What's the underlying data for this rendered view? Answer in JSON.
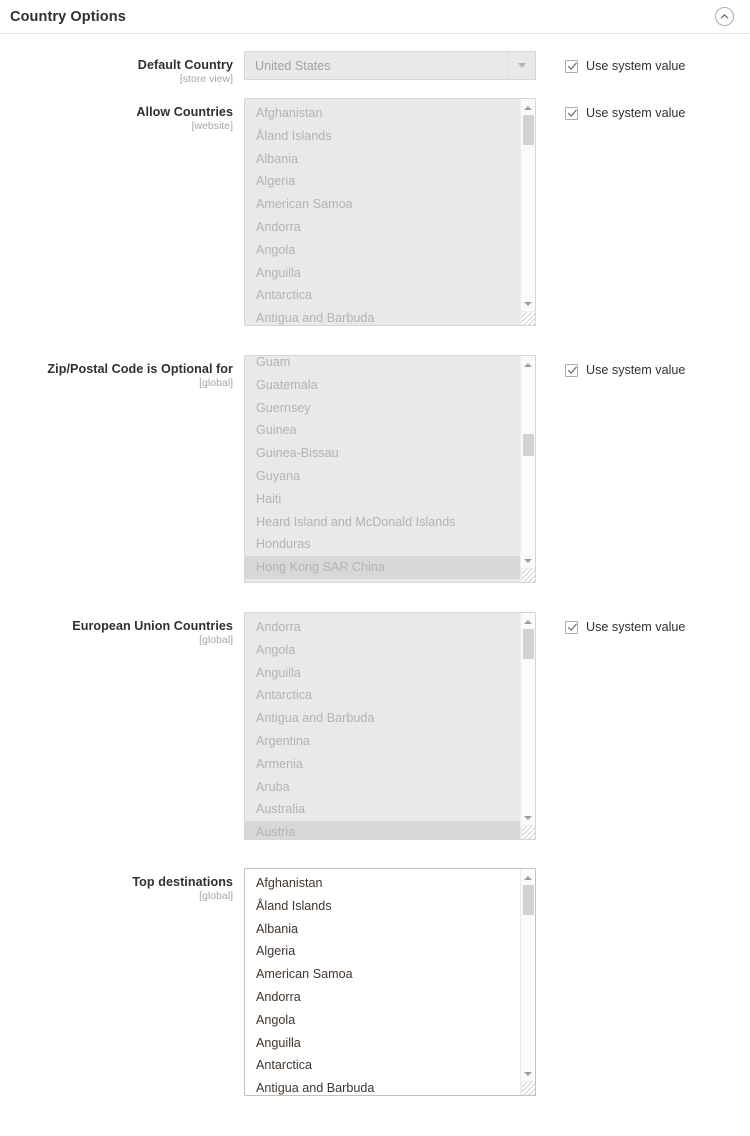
{
  "section": {
    "title": "Country Options",
    "collapse_icon": "chevron-up-circle-icon",
    "collapse_state": "expanded"
  },
  "use_system_value_label": "Use system value",
  "colors": {
    "text": "#303030",
    "disabled_text": "#b3b3b3",
    "enabled_text": "#41362f",
    "scope_text": "#a6a6a6",
    "disabled_bg": "#e9e9e9",
    "enabled_bg": "#ffffff",
    "border": "#d6d6d6",
    "selected_row_bg": "#d8d8d8"
  },
  "fields": [
    {
      "id": "default-country",
      "label": "Default Country",
      "scope": "[store view]",
      "type": "select",
      "disabled": true,
      "value": "United States",
      "use_system_value": {
        "present": true,
        "checked": true,
        "disabled": true
      },
      "options": [
        "United States"
      ]
    },
    {
      "id": "allow-countries",
      "label": "Allow Countries",
      "scope": "[website]",
      "type": "multiselect",
      "disabled": true,
      "use_system_value": {
        "present": true,
        "checked": true,
        "disabled": true
      },
      "scroll_position": "top",
      "options": [
        {
          "label": "Afghanistan",
          "selected": false
        },
        {
          "label": "Åland Islands",
          "selected": false
        },
        {
          "label": "Albania",
          "selected": false
        },
        {
          "label": "Algeria",
          "selected": false
        },
        {
          "label": "American Samoa",
          "selected": false
        },
        {
          "label": "Andorra",
          "selected": false
        },
        {
          "label": "Angola",
          "selected": false
        },
        {
          "label": "Anguilla",
          "selected": false
        },
        {
          "label": "Antarctica",
          "selected": false
        },
        {
          "label": "Antigua and Barbuda",
          "selected": false
        }
      ]
    },
    {
      "id": "zip-postal-code-optional-for",
      "label": "Zip/Postal Code is Optional for",
      "scope": "[global]",
      "type": "multiselect",
      "disabled": true,
      "use_system_value": {
        "present": true,
        "checked": true,
        "disabled": true
      },
      "scroll_position": "middle",
      "options": [
        {
          "label": "Guam",
          "selected": false
        },
        {
          "label": "Guatemala",
          "selected": false
        },
        {
          "label": "Guernsey",
          "selected": false
        },
        {
          "label": "Guinea",
          "selected": false
        },
        {
          "label": "Guinea-Bissau",
          "selected": false
        },
        {
          "label": "Guyana",
          "selected": false
        },
        {
          "label": "Haiti",
          "selected": false
        },
        {
          "label": "Heard Island and McDonald Islands",
          "selected": false
        },
        {
          "label": "Honduras",
          "selected": false
        },
        {
          "label": "Hong Kong SAR China",
          "selected": true
        }
      ]
    },
    {
      "id": "european-union-countries",
      "label": "European Union Countries",
      "scope": "[global]",
      "type": "multiselect",
      "disabled": true,
      "use_system_value": {
        "present": true,
        "checked": true,
        "disabled": true
      },
      "scroll_position": "top",
      "options": [
        {
          "label": "Andorra",
          "selected": false
        },
        {
          "label": "Angola",
          "selected": false
        },
        {
          "label": "Anguilla",
          "selected": false
        },
        {
          "label": "Antarctica",
          "selected": false
        },
        {
          "label": "Antigua and Barbuda",
          "selected": false
        },
        {
          "label": "Argentina",
          "selected": false
        },
        {
          "label": "Armenia",
          "selected": false
        },
        {
          "label": "Aruba",
          "selected": false
        },
        {
          "label": "Australia",
          "selected": false
        },
        {
          "label": "Austria",
          "selected": true
        }
      ]
    },
    {
      "id": "top-destinations",
      "label": "Top destinations",
      "scope": "[global]",
      "type": "multiselect",
      "disabled": false,
      "use_system_value": {
        "present": false,
        "checked": false,
        "disabled": false
      },
      "scroll_position": "top",
      "options": [
        {
          "label": "Afghanistan",
          "selected": false
        },
        {
          "label": "Åland Islands",
          "selected": false
        },
        {
          "label": "Albania",
          "selected": false
        },
        {
          "label": "Algeria",
          "selected": false
        },
        {
          "label": "American Samoa",
          "selected": false
        },
        {
          "label": "Andorra",
          "selected": false
        },
        {
          "label": "Angola",
          "selected": false
        },
        {
          "label": "Anguilla",
          "selected": false
        },
        {
          "label": "Antarctica",
          "selected": false
        },
        {
          "label": "Antigua and Barbuda",
          "selected": false
        }
      ]
    }
  ]
}
